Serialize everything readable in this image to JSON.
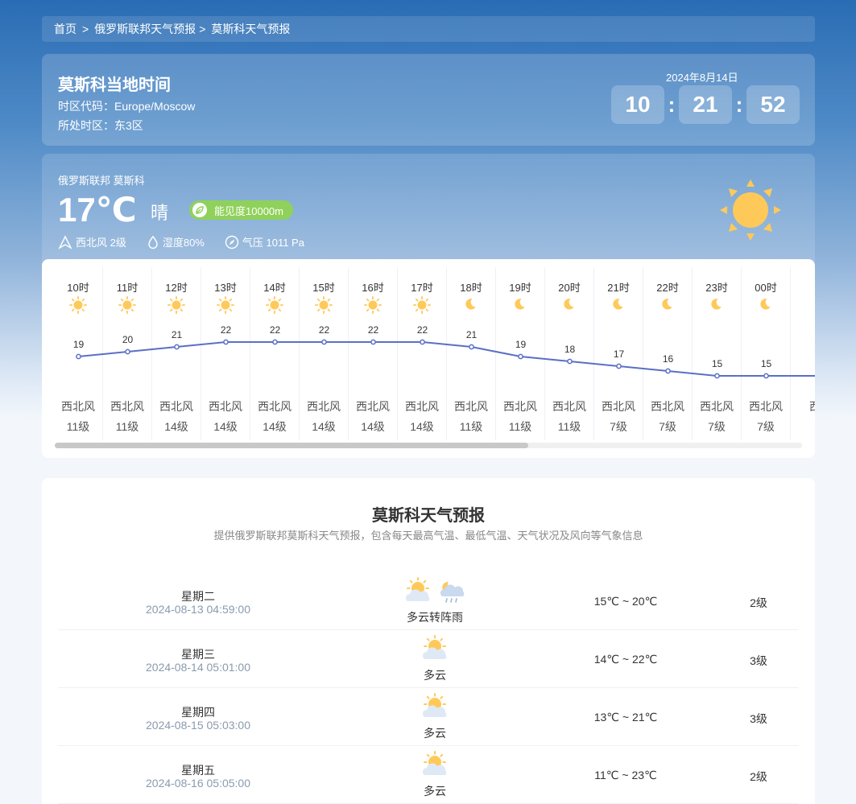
{
  "breadcrumb": {
    "home": "首页",
    "country": "俄罗斯联邦天气预报",
    "city": "莫斯科天气预报"
  },
  "local_time": {
    "title": "莫斯科当地时间",
    "tz_code": "时区代码：Europe/Moscow",
    "zone": "所处时区：东3区",
    "date": "2024年8月14日",
    "hour": "10",
    "minute": "21",
    "second": "52"
  },
  "current": {
    "location": "俄罗斯联邦 莫斯科",
    "temp": "17℃",
    "condition": "晴",
    "visibility": "能见度10000m",
    "wind": "西北风 2级",
    "humidity": "湿度80%",
    "pressure": "气压 1011 Pa",
    "icon": "sun-icon"
  },
  "hourly": [
    {
      "hour": "10时",
      "icon": "sun",
      "temp": 19,
      "dir": "西北风",
      "level": "11级"
    },
    {
      "hour": "11时",
      "icon": "sun",
      "temp": 20,
      "dir": "西北风",
      "level": "11级"
    },
    {
      "hour": "12时",
      "icon": "sun",
      "temp": 21,
      "dir": "西北风",
      "level": "14级"
    },
    {
      "hour": "13时",
      "icon": "sun",
      "temp": 22,
      "dir": "西北风",
      "level": "14级"
    },
    {
      "hour": "14时",
      "icon": "sun",
      "temp": 22,
      "dir": "西北风",
      "level": "14级"
    },
    {
      "hour": "15时",
      "icon": "sun",
      "temp": 22,
      "dir": "西北风",
      "level": "14级"
    },
    {
      "hour": "16时",
      "icon": "sun",
      "temp": 22,
      "dir": "西北风",
      "level": "14级"
    },
    {
      "hour": "17时",
      "icon": "sun",
      "temp": 22,
      "dir": "西北风",
      "level": "14级"
    },
    {
      "hour": "18时",
      "icon": "moon",
      "temp": 21,
      "dir": "西北风",
      "level": "11级"
    },
    {
      "hour": "19时",
      "icon": "moon",
      "temp": 19,
      "dir": "西北风",
      "level": "11级"
    },
    {
      "hour": "20时",
      "icon": "moon",
      "temp": 18,
      "dir": "西北风",
      "level": "11级"
    },
    {
      "hour": "21时",
      "icon": "moon",
      "temp": 17,
      "dir": "西北风",
      "level": "7级"
    },
    {
      "hour": "22时",
      "icon": "moon",
      "temp": 16,
      "dir": "西北风",
      "level": "7级"
    },
    {
      "hour": "23时",
      "icon": "moon",
      "temp": 15,
      "dir": "西北风",
      "level": "7级"
    },
    {
      "hour": "00时",
      "icon": "moon",
      "temp": 15,
      "dir": "西北风",
      "level": "7级"
    },
    {
      "hour": "",
      "icon": "",
      "temp": 15,
      "dir": "西",
      "level": ""
    }
  ],
  "forecast": {
    "title": "莫斯科天气预报",
    "subtitle": "提供俄罗斯联邦莫斯科天气预报，包含每天最高气温、最低气温、天气状况及风向等气象信息",
    "days": [
      {
        "weekday": "星期二",
        "datetime": "2024-08-13 04:59:00",
        "icons": [
          "partly-cloudy",
          "cloud-rain"
        ],
        "desc": "多云转阵雨",
        "temp": "15℃ ~ 20℃",
        "wind": "2级"
      },
      {
        "weekday": "星期三",
        "datetime": "2024-08-14 05:01:00",
        "icons": [
          "partly-cloudy"
        ],
        "desc": "多云",
        "temp": "14℃ ~ 22℃",
        "wind": "3级"
      },
      {
        "weekday": "星期四",
        "datetime": "2024-08-15 05:03:00",
        "icons": [
          "partly-cloudy"
        ],
        "desc": "多云",
        "temp": "13℃ ~ 21℃",
        "wind": "3级"
      },
      {
        "weekday": "星期五",
        "datetime": "2024-08-16 05:05:00",
        "icons": [
          "partly-cloudy"
        ],
        "desc": "多云",
        "temp": "11℃ ~ 23℃",
        "wind": "2级"
      }
    ]
  },
  "colors": {
    "accent": "#5b6fc5",
    "sun": "#ffc95a",
    "badge": "#8fd15a"
  }
}
